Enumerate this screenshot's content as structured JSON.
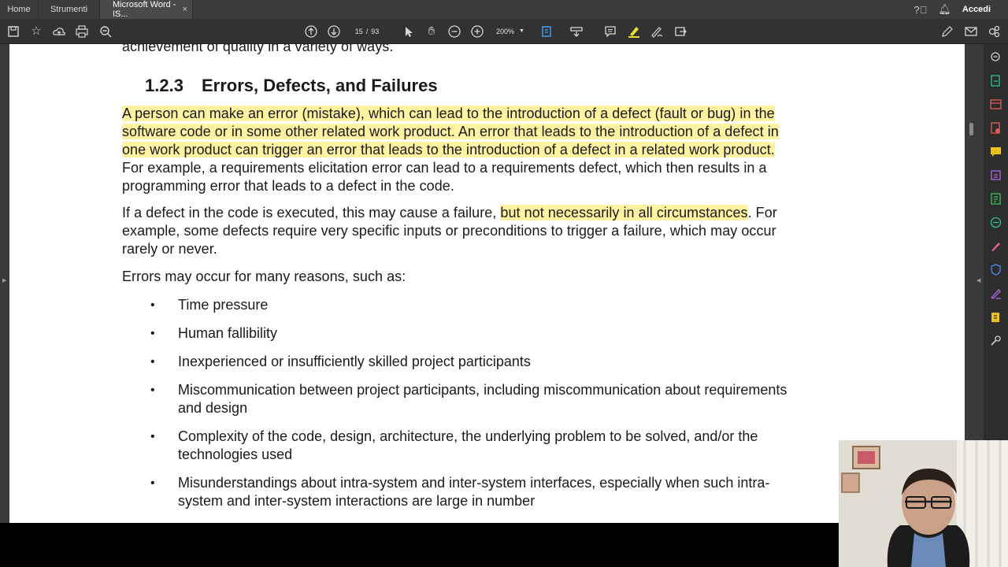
{
  "tabs": {
    "home": "Home",
    "tools": "Strumenti",
    "document": "Microsoft Word - IS...",
    "close": "×",
    "signin": "Accedi"
  },
  "toolbar": {
    "page_current": "15",
    "page_sep": "/",
    "page_total": "93",
    "zoom": "200%",
    "icons": [
      "save-icon",
      "star-icon",
      "upload-icon",
      "print-icon",
      "zoom-out-search-icon",
      "page-up-icon",
      "page-down-icon",
      "pointer-icon",
      "hand-icon",
      "zoom-out-icon",
      "zoom-in-icon",
      "fit-page-icon",
      "scroll-mode-icon",
      "comment-icon",
      "highlighter-icon",
      "sign-icon",
      "share-icon",
      "pen-icon",
      "mail-icon",
      "link-icon"
    ]
  },
  "document": {
    "top_line": "achievement of quality in a variety of ways.",
    "heading_number": "1.2.3",
    "heading_title": "Errors, Defects, and Failures",
    "para1": [
      "A person can make an error (mistake), which can lead to the introduction of a defect (fault or bug) in the",
      "software code or in some other related work product. An error that leads to the introduction of a defect in",
      "one work product can trigger an error that leads to the introduction of a defect in a related work product.",
      "For example, a requirements elicitation error can lead to a requirements defect, which then results in a",
      "programming error that leads to a defect in the code."
    ],
    "para2_line1_a": "If a defect in the code is executed, this may cause a failure, ",
    "para2_line1_b": "but not necessarily in all circumstances",
    "para2_line1_c": ". For",
    "para2_line2": "example, some defects require very specific inputs or preconditions to trigger a failure, which may occur",
    "para2_line3": "rarely or never.",
    "para3": "Errors may occur for many reasons, such as:",
    "bullet_char": "•",
    "bullets": [
      [
        "Time pressure"
      ],
      [
        "Human fallibility"
      ],
      [
        "Inexperienced or insufficiently skilled project participants"
      ],
      [
        "Miscommunication between project participants, including miscommunication about requirements",
        "and design"
      ],
      [
        "Complexity of the code, design, architecture, the underlying problem to be solved, and/or the",
        "technologies used"
      ],
      [
        "Misunderstandings about intra-system and inter-system interfaces, especially when such intra-",
        "system and inter-system interactions are large in number"
      ]
    ]
  },
  "colors": {
    "highlight": "#fff2a0",
    "accent_blue": "#4aa3ff",
    "tabbar": "#3b3b3b",
    "toolbar": "#323232",
    "rightbar": "#2d2d2d"
  }
}
